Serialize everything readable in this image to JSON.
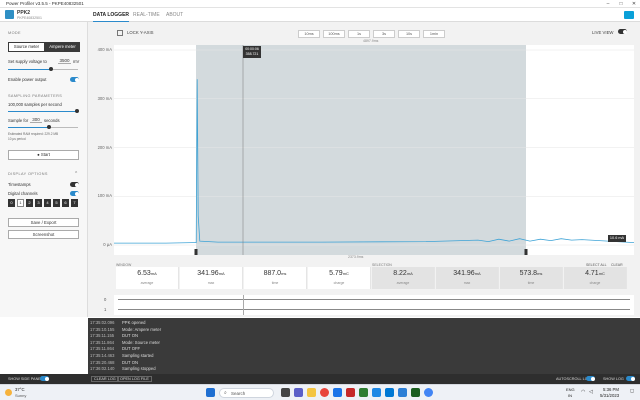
{
  "window": {
    "title": "Power Profiler v3.5.5 - PKPE40832501"
  },
  "device": {
    "name": "PPK2",
    "serial": "PKPE40832501"
  },
  "nav": {
    "tabs": [
      "DATA LOGGER",
      "REAL-TIME",
      "ABOUT"
    ]
  },
  "sidebar": {
    "mode_header": "MODE",
    "source_meter": "Source meter",
    "ampere_meter": "Ampere meter",
    "supply_label": "Set supply voltage to",
    "supply_value": "3500",
    "supply_unit": "mV",
    "supply_level": 0.62,
    "power_output_label": "Enable power output",
    "sampling_header": "SAMPLING PARAMETERS",
    "samples_label": "100,000 samples per second",
    "sample_for_label": "Sample for",
    "sample_for_value": "300",
    "sample_for_unit": "seconds",
    "estimate_line1": "Estimated RAM required: 229.2 MB",
    "estimate_line2": "10 µs period",
    "start_button": "Start",
    "display_header": "DISPLAY OPTIONS",
    "timestamps_label": "Timestamps",
    "digital_channels_label": "Digital channels",
    "channels": [
      "0",
      "1",
      "2",
      "3",
      "4",
      "5",
      "6",
      "7"
    ],
    "save_export": "Save / Export",
    "screenshot": "Screenshot"
  },
  "toolbar": {
    "lock_y_axis": "LOCK Y-AXIS",
    "zoom_buttons": [
      "10ms",
      "100ms",
      "1s",
      "3s",
      "10s",
      "1min"
    ],
    "live_view": "LIVE VIEW"
  },
  "chart_data": {
    "type": "line",
    "y_ticks": [
      "400 mA",
      "300 mA",
      "200 mA",
      "100 mA",
      "0 µA"
    ],
    "ylim": [
      0,
      400
    ],
    "window_label": "4897.9ms",
    "selection_label": "2373.9ms",
    "cursor_time": "00:00:06",
    "cursor_value": "358.721",
    "current_value_label": "10.6 mA",
    "series": [
      {
        "values": [
          [
            0.0,
            4
          ],
          [
            0.1,
            4
          ],
          [
            0.15,
            5
          ],
          [
            0.158,
            5
          ],
          [
            0.16,
            340
          ],
          [
            0.162,
            60
          ],
          [
            0.165,
            8
          ],
          [
            0.2,
            6
          ],
          [
            0.4,
            6
          ],
          [
            0.6,
            7
          ],
          [
            0.7,
            10
          ],
          [
            0.72,
            7
          ],
          [
            0.74,
            12
          ],
          [
            0.76,
            8
          ],
          [
            0.78,
            13
          ],
          [
            0.8,
            8
          ],
          [
            0.82,
            12
          ],
          [
            0.84,
            9
          ],
          [
            0.86,
            13
          ],
          [
            0.88,
            10
          ],
          [
            0.9,
            11
          ],
          [
            1.0,
            5
          ]
        ]
      }
    ]
  },
  "stats": {
    "window": {
      "label": "WINDOW",
      "items": [
        {
          "value": "6.53",
          "unit": "mA",
          "label": "average"
        },
        {
          "value": "341.96",
          "unit": "mA",
          "label": "max"
        },
        {
          "value": "887.0",
          "unit": "ms",
          "label": "time"
        },
        {
          "value": "5.79",
          "unit": "mC",
          "label": "charge"
        }
      ]
    },
    "selection": {
      "label": "SELECTION",
      "select_all": "SELECT ALL",
      "clear": "CLEAR",
      "items": [
        {
          "value": "8.22",
          "unit": "mA",
          "label": "average"
        },
        {
          "value": "341.96",
          "unit": "mA",
          "label": "max"
        },
        {
          "value": "573.8",
          "unit": "ms",
          "label": "time"
        },
        {
          "value": "4.71",
          "unit": "mC",
          "label": "charge"
        }
      ]
    }
  },
  "digital": {
    "rows": [
      "0",
      "1"
    ]
  },
  "log": {
    "entries": [
      {
        "time": "17:35:02.096",
        "message": "PPK opened"
      },
      {
        "time": "17:35:10.155",
        "message": "Mode: Ampere meter"
      },
      {
        "time": "17:35:11.155",
        "message": "DUT ON"
      },
      {
        "time": "17:35:11.864",
        "message": "Mode: Source meter"
      },
      {
        "time": "17:35:11.864",
        "message": "DUT OFF"
      },
      {
        "time": "17:35:14.463",
        "message": "Sampling started"
      },
      {
        "time": "17:35:20.468",
        "message": "DUT ON"
      },
      {
        "time": "17:36:02.140",
        "message": "Sampling stopped"
      }
    ]
  },
  "bottombar": {
    "show_side_panel": "SHOW SIDE PANEL",
    "open_log": "OPEN LOG FILE",
    "autoscroll": "AUTOSCROLL LOG",
    "show_log": "SHOW LOG"
  },
  "taskbar": {
    "weather_temp": "37°C",
    "weather_desc": "Sunny",
    "search": "Search",
    "lang": "ENG",
    "region": "IN",
    "time": "5:36 PM",
    "date": "5/31/2023"
  },
  "colors": {
    "accent": "#2b8acb",
    "trace": "#3ea3d6",
    "log_bg": "#3a3a3a"
  }
}
